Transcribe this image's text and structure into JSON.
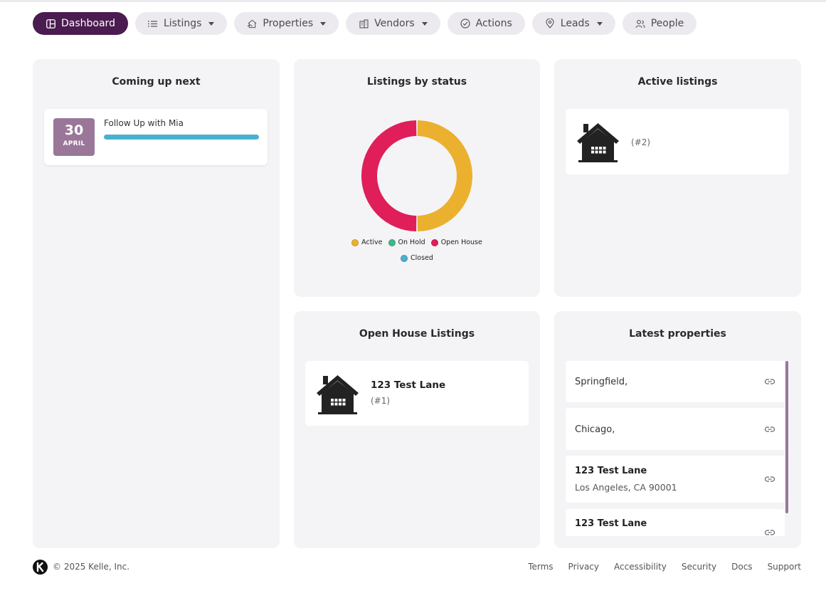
{
  "nav": {
    "dashboard": "Dashboard",
    "listings": "Listings",
    "properties": "Properties",
    "vendors": "Vendors",
    "actions": "Actions",
    "leads": "Leads",
    "people": "People"
  },
  "coming_up": {
    "title": "Coming up next",
    "event": {
      "day": "30",
      "month": "APRIL",
      "title": "Follow Up with Mia",
      "progress": 1.0
    }
  },
  "status_chart": {
    "title": "Listings by status",
    "legend": [
      "Active",
      "On Hold",
      "Open House",
      "Closed"
    ]
  },
  "chart_data": {
    "type": "pie",
    "title": "Listings by status",
    "categories": [
      "Active",
      "On Hold",
      "Open House",
      "Closed"
    ],
    "values": [
      1,
      0,
      1,
      0
    ],
    "colors": [
      "#ebb02e",
      "#3fb88a",
      "#e01e5a",
      "#4ab0cf"
    ],
    "donut": true,
    "legend": "bottom"
  },
  "active_listings": {
    "title": "Active listings",
    "items": [
      {
        "name": "",
        "id": "(#2)"
      }
    ]
  },
  "open_house": {
    "title": "Open House Listings",
    "items": [
      {
        "name": "123 Test Lane",
        "id": "(#1)"
      }
    ]
  },
  "latest_properties": {
    "title": "Latest properties",
    "items": [
      {
        "name": "Springfield,",
        "address": ""
      },
      {
        "name": "Chicago,",
        "address": ""
      },
      {
        "name": "123 Test Lane",
        "address": "Los Angeles, CA 90001"
      },
      {
        "name": "123 Test Lane",
        "address": ""
      }
    ]
  },
  "footer": {
    "copyright": "© 2025 Kelle, Inc.",
    "links": [
      "Terms",
      "Privacy",
      "Accessibility",
      "Security",
      "Docs",
      "Support"
    ]
  },
  "colors": {
    "brand": "#4a1c4f",
    "accent": "#9a7799",
    "progress": "#4ab0cf"
  }
}
